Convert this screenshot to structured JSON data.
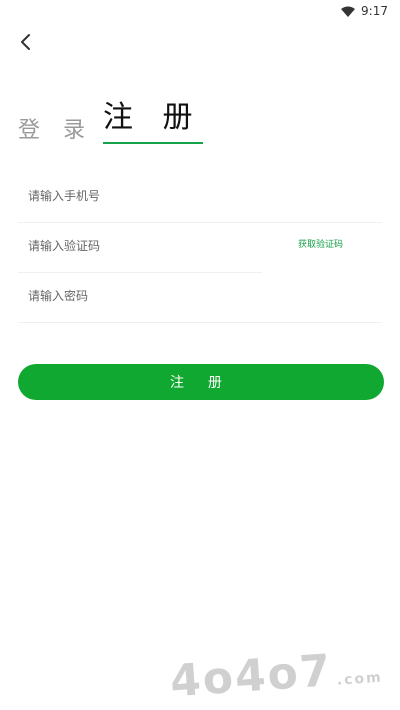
{
  "status": {
    "time": "9:17"
  },
  "tabs": {
    "login": "登 录",
    "register": "注 册"
  },
  "fields": {
    "phone_placeholder": "请输入手机号",
    "code_placeholder": "请输入验证码",
    "password_placeholder": "请输入密码"
  },
  "get_code_label": "获取验证码",
  "submit_label": "注 册",
  "watermark": {
    "text": "4o4o7",
    "suffix": ".com"
  },
  "colors": {
    "accent": "#10a830",
    "placeholder": "#666666"
  }
}
